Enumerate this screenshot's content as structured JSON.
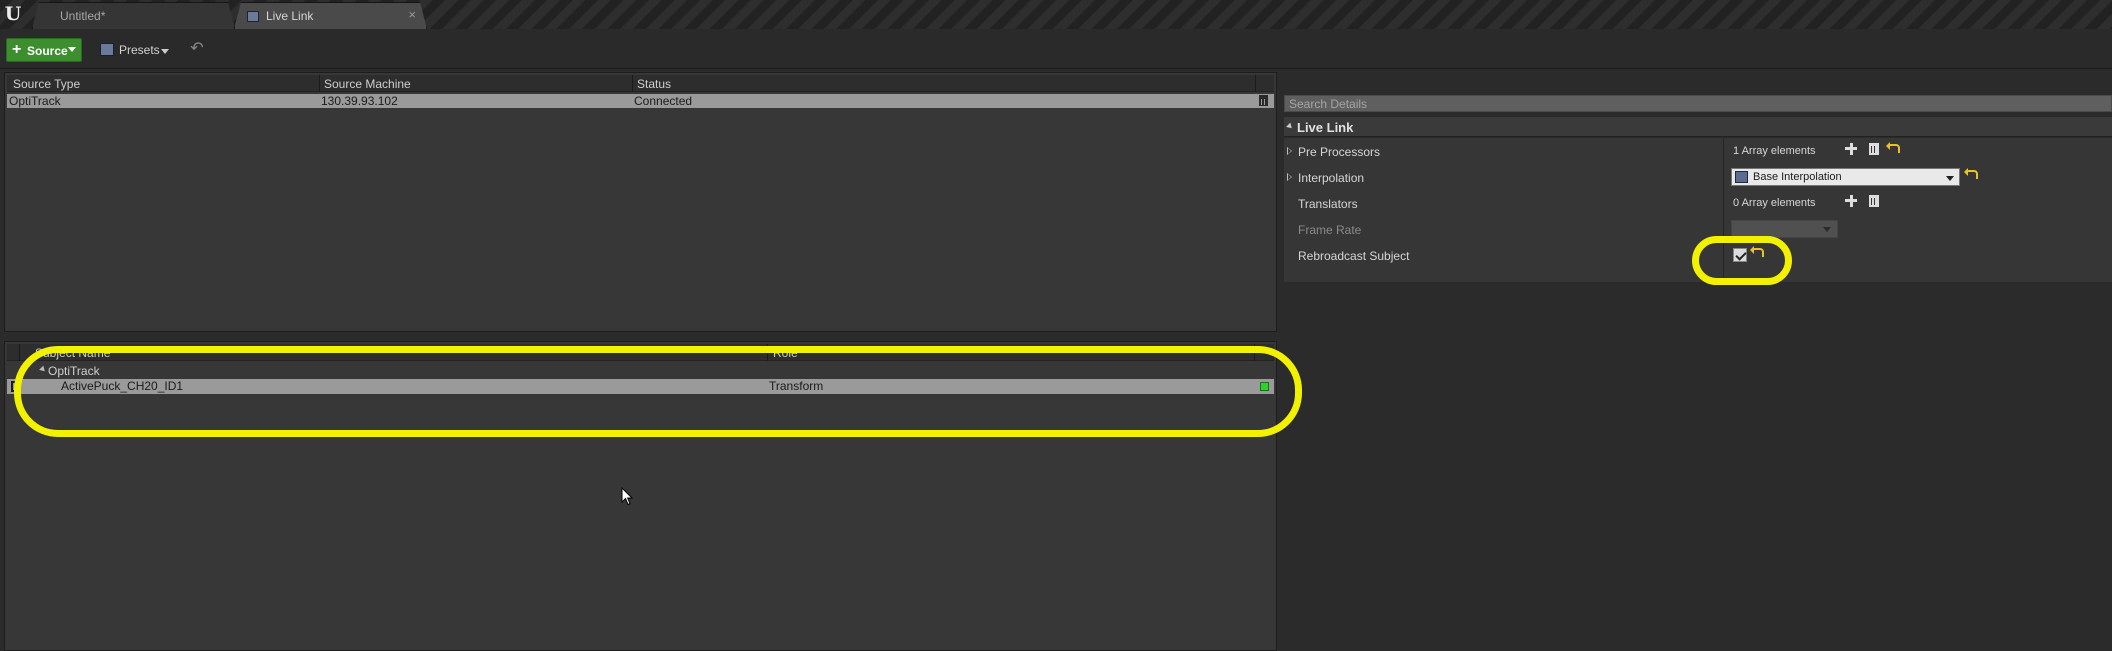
{
  "window": {
    "tabs": [
      {
        "label": "Untitled*"
      },
      {
        "label": "Live Link"
      }
    ],
    "tab_close_glyph": "×",
    "logo_glyph": "U"
  },
  "toolbar": {
    "source_label": "Source",
    "presets_label": "Presets",
    "undo_glyph": "↶"
  },
  "sources": {
    "columns": [
      "Source Type",
      "Source Machine",
      "Status"
    ],
    "rows": [
      {
        "type": "OptiTrack",
        "machine": "130.39.93.102",
        "status": "Connected"
      }
    ]
  },
  "subjects": {
    "columns": [
      "Subject Name",
      "Role"
    ],
    "groups": [
      {
        "name": "OptiTrack",
        "items": [
          {
            "name": "ActivePuck_CH20_ID1",
            "role": "Transform",
            "status_color": "#2ed12e"
          }
        ]
      }
    ]
  },
  "details": {
    "search_placeholder": "Search Details",
    "category": "Live Link",
    "properties": {
      "pre_processors": {
        "name": "Pre Processors",
        "value": "1 Array elements"
      },
      "interpolation": {
        "name": "Interpolation",
        "value": "Base Interpolation"
      },
      "translators": {
        "name": "Translators",
        "value": "0 Array elements"
      },
      "frame_rate": {
        "name": "Frame Rate"
      },
      "rebroadcast": {
        "name": "Rebroadcast Subject",
        "checked": true
      }
    }
  },
  "highlight_color": "#f2f200"
}
